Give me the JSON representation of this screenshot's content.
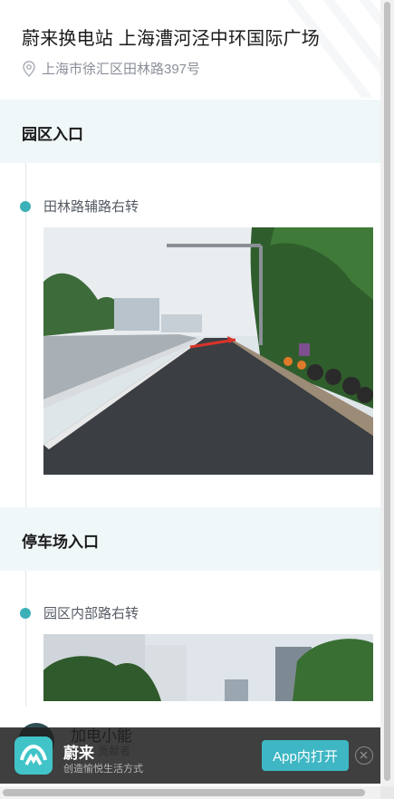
{
  "header": {
    "title": "蔚来换电站 上海漕河泾中环国际广场",
    "address": "上海市徐汇区田林路397号"
  },
  "sections": [
    {
      "title": "园区入口",
      "step": "田林路辅路右转"
    },
    {
      "title": "停车场入口",
      "step": "园区内部路右转"
    }
  ],
  "contributor": {
    "name": "加电小能",
    "role": "贡献者"
  },
  "banner": {
    "brand": "蔚来",
    "slogan": "创造愉悦生活方式",
    "open_label": "App内打开"
  },
  "colors": {
    "accent": "#3bb0b8",
    "section_bg": "#f0f7f9",
    "button": "#3fb6c4"
  },
  "icons": [
    "location-pin-icon",
    "nio-logo-icon",
    "close-icon"
  ]
}
